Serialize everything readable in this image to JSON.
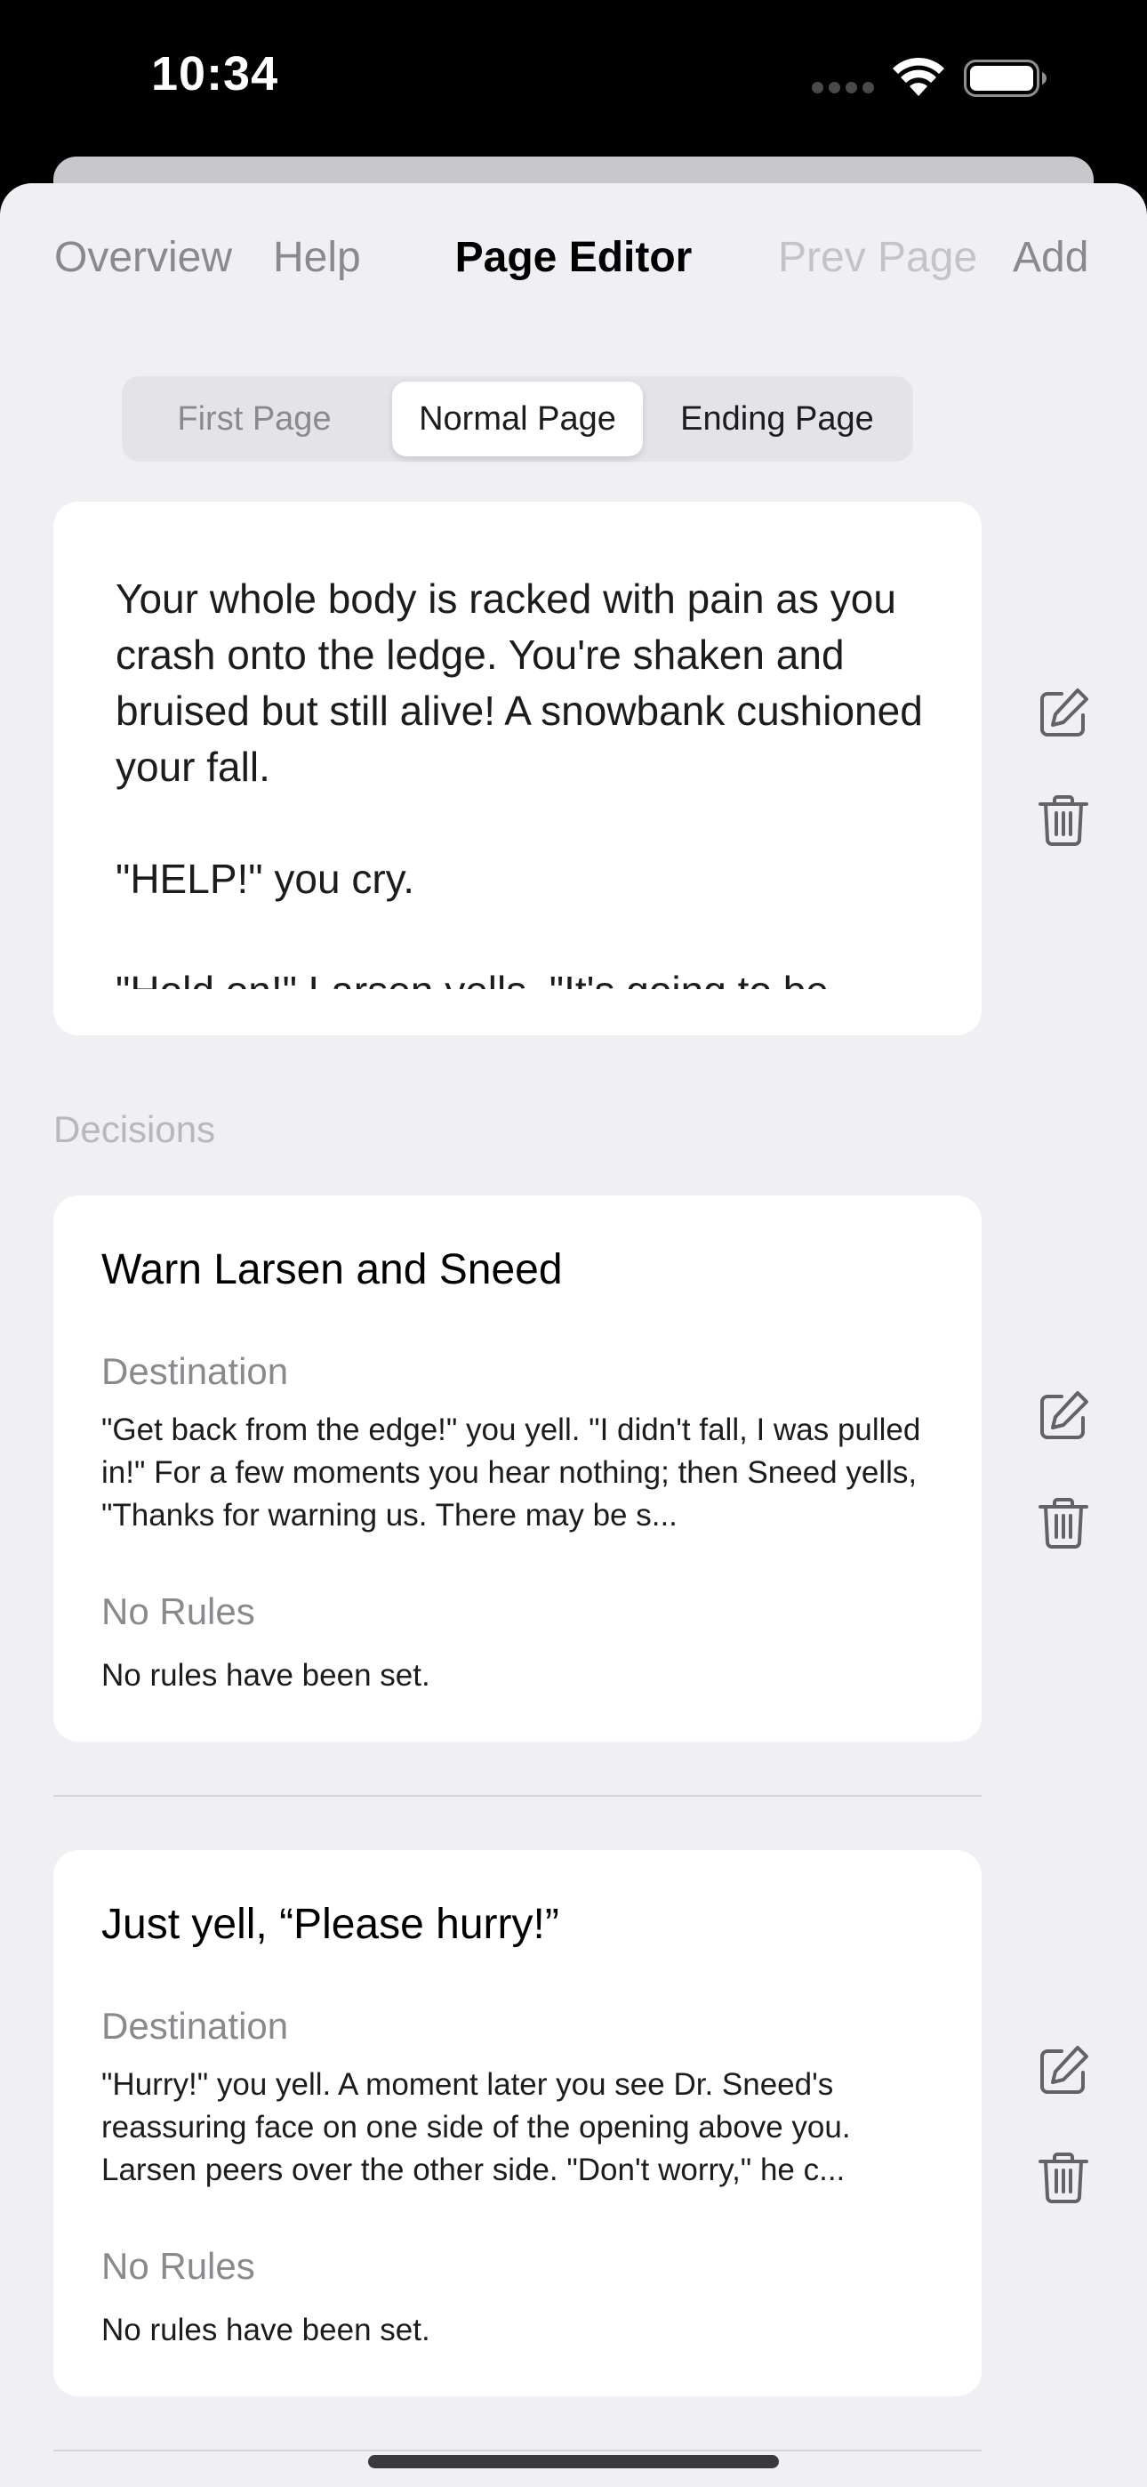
{
  "status_bar": {
    "time": "10:34",
    "icons": [
      "cellular-signal-icon",
      "wifi-icon",
      "battery-icon"
    ]
  },
  "nav": {
    "overview": "Overview",
    "help": "Help",
    "title": "Page Editor",
    "prev_page": "Prev Page",
    "add": "Add"
  },
  "segments": {
    "first": "First Page",
    "normal": "Normal Page",
    "ending": "Ending Page",
    "selected": "Normal Page"
  },
  "page_text": "Your whole body is racked with pain as you crash onto the ledge. You're shaken and bruised but still alive! A snowbank cushioned your fall.\n\n\"HELP!\" you cry.\n\n\"Hold on!\" Larsen yells. \"It's going to be",
  "decisions_header": "Decisions",
  "decisions": [
    {
      "title": "Warn Larsen and Sneed",
      "destination_label": "Destination",
      "destination_text": "\"Get back from the edge!\" you yell. \"I didn't fall, I was pulled in!\" For a few moments you hear nothing; then Sneed yells, \"Thanks for warning us. There may be s...",
      "rules_label": "No Rules",
      "rules_text": "No rules have been set."
    },
    {
      "title": "Just yell, “Please hurry!”",
      "destination_label": "Destination",
      "destination_text": "\"Hurry!\" you yell. A moment later you see Dr. Sneed's reassuring face on one side of the opening above you. Larsen peers over the other side. \"Don't worry,\" he c...",
      "rules_label": "No Rules",
      "rules_text": "No rules have been set."
    }
  ],
  "icons": {
    "edit": "edit-icon",
    "delete": "trash-icon"
  },
  "colors": {
    "sheet_background": "#efeff4",
    "card_background": "#ffffff",
    "secondary_text": "#8a8a8e",
    "disabled_text": "#c4c4c8"
  }
}
